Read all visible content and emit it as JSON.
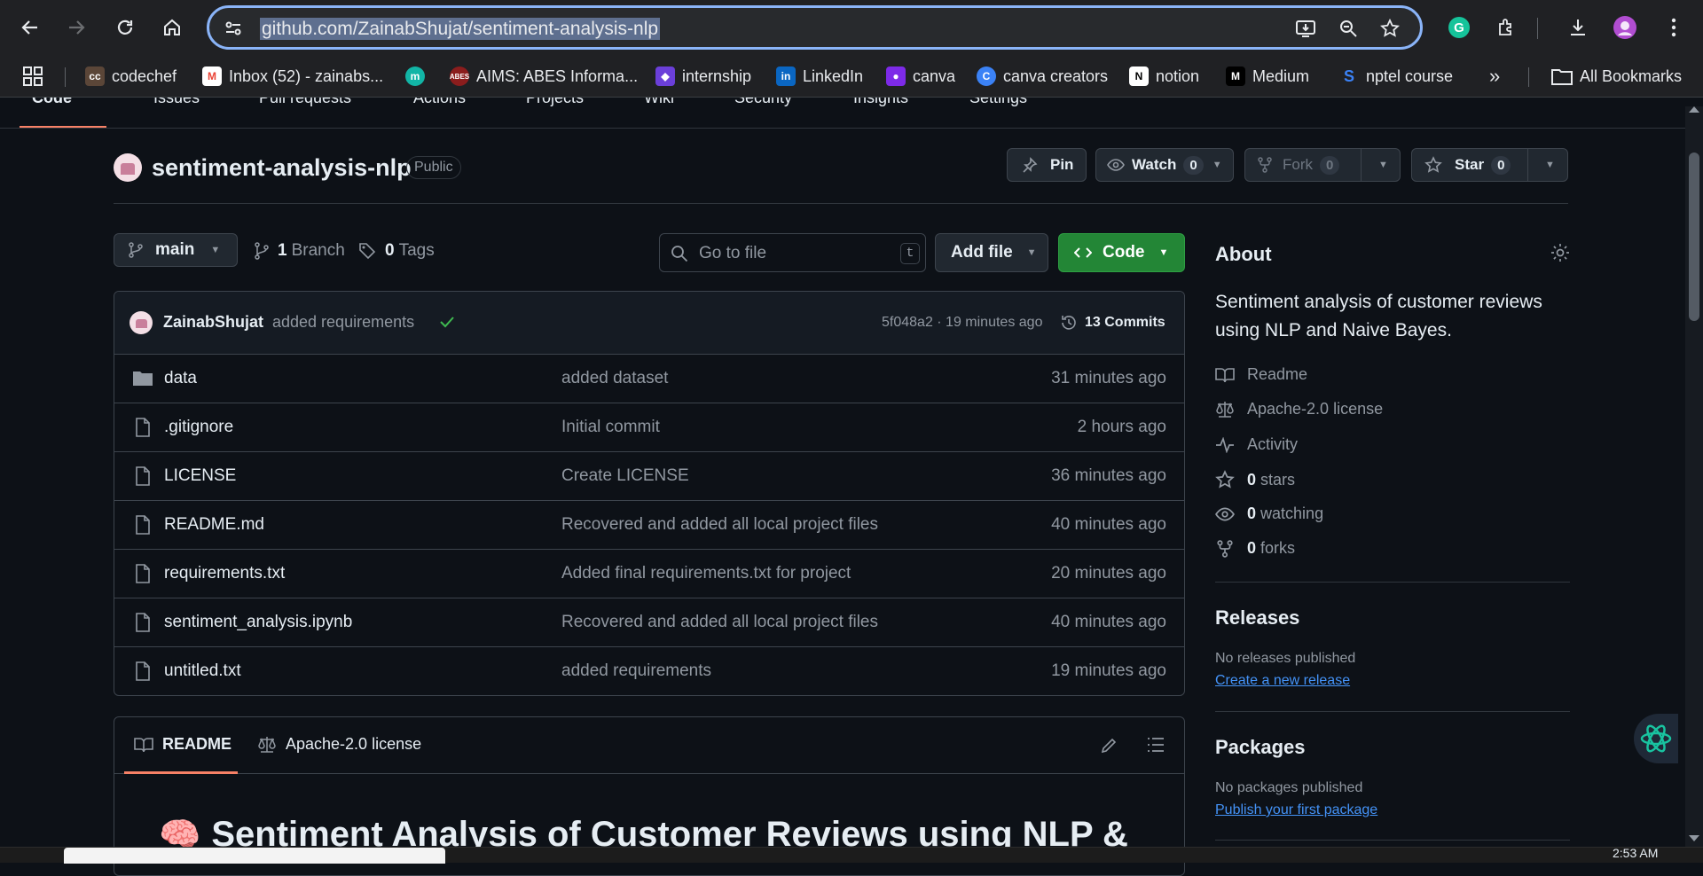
{
  "browser": {
    "url": "github.com/ZainabShujat/sentiment-analysis-nlp",
    "bookmarks": [
      "codechef",
      "Inbox (52) - zainabs...",
      "",
      "AIMS: ABES Informa...",
      "internship",
      "LinkedIn",
      "canva",
      "canva creators",
      "notion",
      "Medium",
      "nptel course"
    ],
    "all_bookmarks": "All Bookmarks",
    "more": "»"
  },
  "repo_nav": {
    "tabs": [
      "Code",
      "Issues",
      "Pull requests",
      "Actions",
      "Projects",
      "Wiki",
      "Security",
      "Insights",
      "Settings"
    ]
  },
  "repo": {
    "name": "sentiment-analysis-nlp",
    "visibility": "Public",
    "pin_label": "Pin",
    "watch_label": "Watch",
    "watch_count": "0",
    "fork_label": "Fork",
    "fork_count": "0",
    "star_label": "Star",
    "star_count": "0"
  },
  "toolbar": {
    "branch": "main",
    "branches_count": "1",
    "branches_label": "Branch",
    "tags_count": "0",
    "tags_label": "Tags",
    "search_placeholder": "Go to file",
    "search_key": "t",
    "add_file": "Add file",
    "code": "Code"
  },
  "commit": {
    "author": "ZainabShujat",
    "message": "added requirements",
    "sha_time": "5f048a2 · 19 minutes ago",
    "commits_label": "13 Commits"
  },
  "files": [
    {
      "name": "data",
      "type": "folder",
      "message": "added dataset",
      "time": "31 minutes ago"
    },
    {
      "name": ".gitignore",
      "type": "file",
      "message": "Initial commit",
      "time": "2 hours ago"
    },
    {
      "name": "LICENSE",
      "type": "file",
      "message": "Create LICENSE",
      "time": "36 minutes ago"
    },
    {
      "name": "README.md",
      "type": "file",
      "message": "Recovered and added all local project files",
      "time": "40 minutes ago"
    },
    {
      "name": "requirements.txt",
      "type": "file",
      "message": "Added final requirements.txt for project",
      "time": "20 minutes ago"
    },
    {
      "name": "sentiment_analysis.ipynb",
      "type": "file",
      "message": "Recovered and added all local project files",
      "time": "40 minutes ago"
    },
    {
      "name": "untitled.txt",
      "type": "file",
      "message": "added requirements",
      "time": "19 minutes ago"
    }
  ],
  "readme": {
    "tab_readme": "README",
    "tab_license": "Apache-2.0 license",
    "heading": "Sentiment Analysis of Customer Reviews using NLP &"
  },
  "about": {
    "title": "About",
    "description": "Sentiment analysis of customer reviews using NLP and Naive Bayes.",
    "readme": "Readme",
    "license": "Apache-2.0 license",
    "activity": "Activity",
    "stars_count": "0",
    "stars_label": "stars",
    "watching_count": "0",
    "watching_label": "watching",
    "forks_count": "0",
    "forks_label": "forks"
  },
  "releases": {
    "title": "Releases",
    "none": "No releases published",
    "create_link": "Create a new release"
  },
  "packages": {
    "title": "Packages",
    "none": "No packages published",
    "publish_link": "Publish your first package"
  },
  "clock": "2:53 AM",
  "colors": {
    "accent_green": "#238636",
    "link_blue": "#4493f8",
    "tab_underline": "#f78166"
  }
}
